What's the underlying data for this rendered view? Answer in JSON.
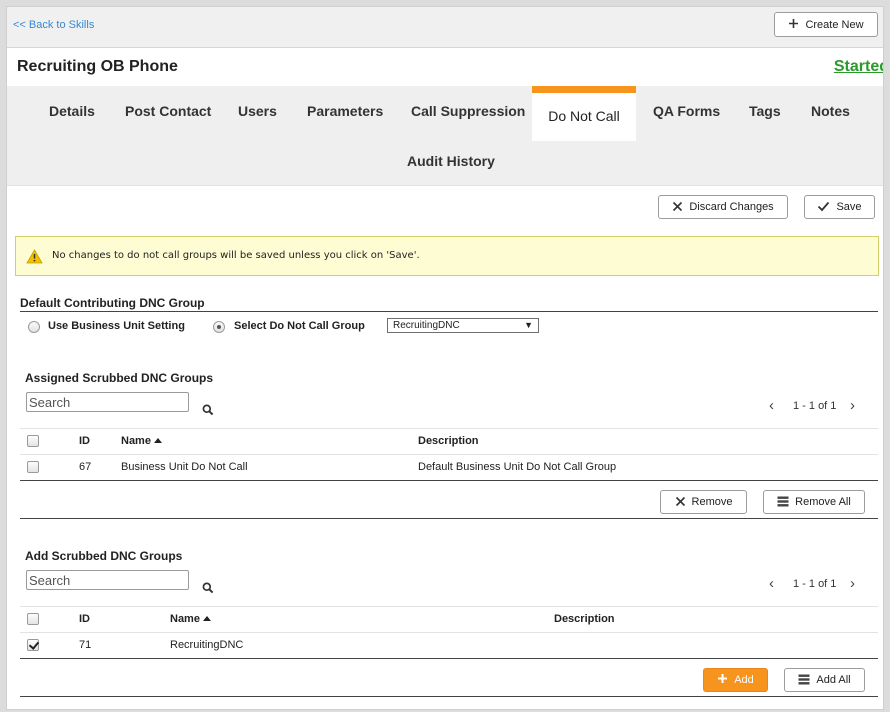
{
  "topbar": {
    "back_link": "<< Back to Skills",
    "create_new": "Create New"
  },
  "header": {
    "title": "Recruiting OB Phone",
    "status": "Started"
  },
  "tabs": {
    "details": "Details",
    "post_contact": "Post Contact",
    "users": "Users",
    "parameters": "Parameters",
    "call_suppression": "Call Suppression",
    "do_not_call": "Do Not Call",
    "qa_forms": "QA Forms",
    "tags": "Tags",
    "notes": "Notes",
    "audit_history": "Audit History",
    "active": "Do Not Call"
  },
  "actions": {
    "discard": "Discard Changes",
    "save": "Save"
  },
  "warning": {
    "text": "No changes to do not call groups will be saved unless you click on 'Save'."
  },
  "default_group": {
    "heading": "Default Contributing DNC Group",
    "option_bu": "Use Business Unit Setting",
    "option_select": "Select Do Not Call Group",
    "selected_option": "select",
    "select_value": "RecruitingDNC"
  },
  "assigned": {
    "heading": "Assigned Scrubbed DNC Groups",
    "search_placeholder": "Search",
    "pager": "1 - 1 of 1",
    "columns": {
      "id": "ID",
      "name": "Name",
      "description": "Description"
    },
    "rows": [
      {
        "id": "67",
        "name": "Business Unit Do Not Call",
        "description": "Default Business Unit Do Not Call Group",
        "checked": false
      }
    ],
    "remove": "Remove",
    "remove_all": "Remove All"
  },
  "add_groups": {
    "heading": "Add Scrubbed DNC Groups",
    "search_placeholder": "Search",
    "pager": "1 - 1 of 1",
    "columns": {
      "id": "ID",
      "name": "Name",
      "description": "Description"
    },
    "rows": [
      {
        "id": "71",
        "name": "RecruitingDNC",
        "description": "",
        "checked": true
      }
    ],
    "add": "Add",
    "add_all": "Add All"
  },
  "colors": {
    "accent": "#f7941d",
    "link": "#3a87d1",
    "status": "#2a9a2a",
    "warning_bg": "#fdfcd2"
  }
}
